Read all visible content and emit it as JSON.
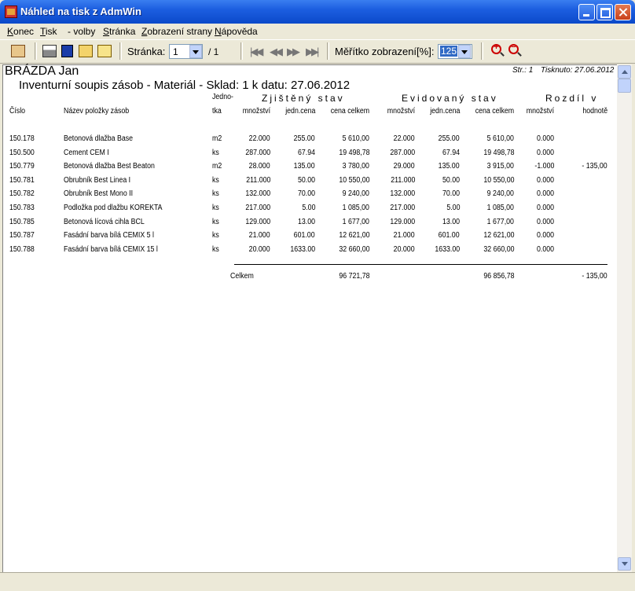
{
  "window": {
    "title": "Náhled na tisk z AdmWin"
  },
  "menu": [
    {
      "label": "Konec",
      "u": "K",
      "rest": "onec"
    },
    {
      "label": "Tisk",
      "u": "T",
      "rest": "isk"
    },
    {
      "label": "- volby",
      "u": "",
      "rest": "- volby"
    },
    {
      "label": "Stránka",
      "u": "S",
      "rest": "tránka"
    },
    {
      "label": "Zobrazení strany",
      "u": "Z",
      "rest": "obrazení strany"
    },
    {
      "label": "Nápověda",
      "u": "N",
      "rest": "ápověda"
    }
  ],
  "toolbar": {
    "page_label": "Stránka:",
    "page_value": "1",
    "page_total": "/ 1",
    "zoom_label": "Měřítko zobrazení[%]:",
    "zoom_value": "125"
  },
  "report": {
    "company": "BRÁZDA Jan",
    "title": "Inventurní soupis zásob - Materiál - Sklad: 1 k datu: 27.06.2012",
    "page": "Str.: 1",
    "printed": "Tisknuto: 27.06.2012",
    "groups": {
      "found": "Zjištěný stav",
      "recorded": "Evidovaný stav",
      "diff": "Rozdíl v"
    },
    "headers": {
      "cislo": "Číslo",
      "nazev": "Název položky zásob",
      "jedn1": "Jedno-",
      "jedn2": "tka",
      "f_mn": "množství",
      "f_jc": "jedn.cena",
      "f_cc": "cena celkem",
      "e_mn": "množství",
      "e_jc": "jedn.cena",
      "e_cc": "cena celkem",
      "d_mn": "množství",
      "d_hod": "hodnotě"
    },
    "rows": [
      {
        "cislo": "150.178",
        "nazev": "Betonová dlažba Base",
        "jedn": "m2",
        "f_mn": "22.000",
        "f_jc": "255.00",
        "f_cc": "5 610,00",
        "e_mn": "22.000",
        "e_jc": "255.00",
        "e_cc": "5 610,00",
        "d_mn": "0.000",
        "d_hod": ""
      },
      {
        "cislo": "150.500",
        "nazev": "Cement CEM I",
        "jedn": "ks",
        "f_mn": "287.000",
        "f_jc": "67.94",
        "f_cc": "19 498,78",
        "e_mn": "287.000",
        "e_jc": "67.94",
        "e_cc": "19 498,78",
        "d_mn": "0.000",
        "d_hod": ""
      },
      {
        "cislo": "150.779",
        "nazev": "Betonová dlažba Best Beaton",
        "jedn": "m2",
        "f_mn": "28.000",
        "f_jc": "135.00",
        "f_cc": "3 780,00",
        "e_mn": "29.000",
        "e_jc": "135.00",
        "e_cc": "3 915,00",
        "d_mn": "-1.000",
        "d_hod": "- 135,00"
      },
      {
        "cislo": "150.781",
        "nazev": "Obrubník Best Linea I",
        "jedn": "ks",
        "f_mn": "211.000",
        "f_jc": "50.00",
        "f_cc": "10 550,00",
        "e_mn": "211.000",
        "e_jc": "50.00",
        "e_cc": "10 550,00",
        "d_mn": "0.000",
        "d_hod": ""
      },
      {
        "cislo": "150.782",
        "nazev": "Obrubník Best Mono II",
        "jedn": "ks",
        "f_mn": "132.000",
        "f_jc": "70.00",
        "f_cc": "9 240,00",
        "e_mn": "132.000",
        "e_jc": "70.00",
        "e_cc": "9 240,00",
        "d_mn": "0.000",
        "d_hod": ""
      },
      {
        "cislo": "150.783",
        "nazev": "Podložka pod dlažbu KOREKTA",
        "jedn": "ks",
        "f_mn": "217.000",
        "f_jc": "5.00",
        "f_cc": "1 085,00",
        "e_mn": "217.000",
        "e_jc": "5.00",
        "e_cc": "1 085,00",
        "d_mn": "0.000",
        "d_hod": ""
      },
      {
        "cislo": "150.785",
        "nazev": "Betonová lícová cihla BCL",
        "jedn": "ks",
        "f_mn": "129.000",
        "f_jc": "13.00",
        "f_cc": "1 677,00",
        "e_mn": "129.000",
        "e_jc": "13.00",
        "e_cc": "1 677,00",
        "d_mn": "0.000",
        "d_hod": ""
      },
      {
        "cislo": "150.787",
        "nazev": "Fasádní barva bílá CEMIX 5 l",
        "jedn": "ks",
        "f_mn": "21.000",
        "f_jc": "601.00",
        "f_cc": "12 621,00",
        "e_mn": "21.000",
        "e_jc": "601.00",
        "e_cc": "12 621,00",
        "d_mn": "0.000",
        "d_hod": ""
      },
      {
        "cislo": "150.788",
        "nazev": "Fasádní barva bílá CEMIX 15 l",
        "jedn": "ks",
        "f_mn": "20.000",
        "f_jc": "1633.00",
        "f_cc": "32 660,00",
        "e_mn": "20.000",
        "e_jc": "1633.00",
        "e_cc": "32 660,00",
        "d_mn": "0.000",
        "d_hod": ""
      }
    ],
    "total": {
      "label": "Celkem",
      "f_cc": "96 721,78",
      "e_cc": "96 856,78",
      "d_hod": "- 135,00"
    }
  }
}
